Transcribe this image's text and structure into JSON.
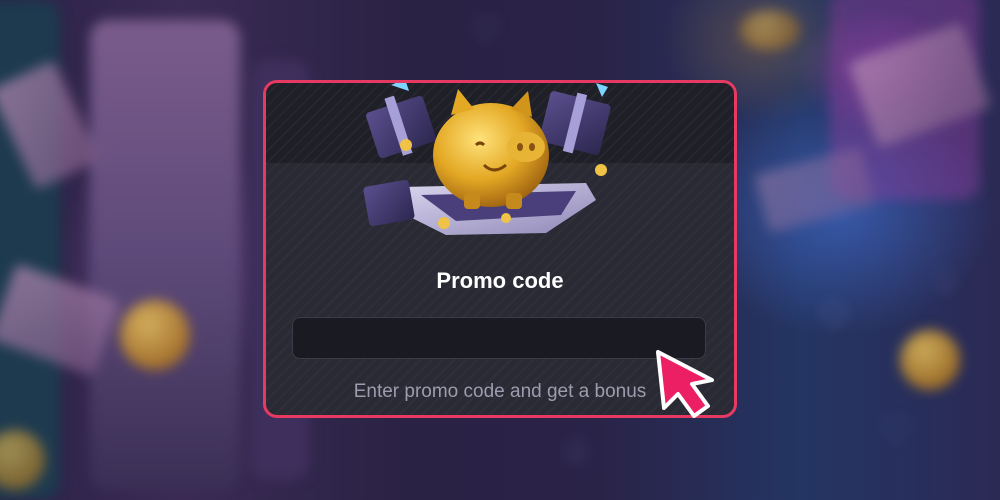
{
  "promo": {
    "title": "Promo code",
    "input_value": "",
    "input_placeholder": "",
    "hint": "Enter promo code and get a bonus"
  },
  "colors": {
    "card_border": "#e63a63",
    "card_background": "#2a2a34",
    "input_background": "#1a1a22",
    "title_text": "#ffffff",
    "hint_text": "#9c9cae",
    "cursor": "#ec1e64"
  },
  "icons": {
    "illustration": "piggy-bank-illustration-icon",
    "pointer": "cursor-arrow-icon"
  }
}
